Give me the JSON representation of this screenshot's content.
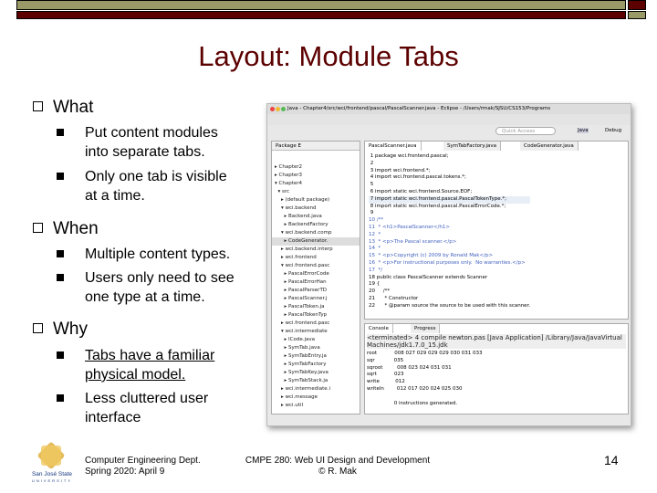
{
  "colors": {
    "olive": "#9a9a68",
    "maroon": "#5c0000"
  },
  "title": "Layout: Module Tabs",
  "bullets": [
    {
      "label": "What",
      "items": [
        "Put content modules into separate tabs.",
        "Only one tab is visible at a time."
      ]
    },
    {
      "label": "When",
      "items": [
        "Multiple content types.",
        "Users only need to see one type at a time."
      ]
    },
    {
      "label": "Why",
      "items": [
        "Tabs have a familiar physical model.",
        "Less cluttered user interface"
      ]
    }
  ],
  "footer": {
    "dept": "Computer Engineering Dept.",
    "date": "Spring 2020: April 9",
    "course": "CMPE 280: Web UI Design and Development",
    "author": "© R. Mak",
    "page": "14",
    "logo_text": "San José State UNIVERSITY"
  },
  "eclipse": {
    "window_title": "Java - Chapter4/src/wci/frontend/pascal/PascalScanner.java - Eclipse - /Users/rmak/SJSU/CS153/Programs",
    "quick_access": "Quick Access",
    "perspectives": [
      "Java",
      "Debug"
    ],
    "package_tab": "Package E",
    "tree": [
      "▸ Chapter2",
      "▸ Chapter3",
      "▾ Chapter4",
      "  ▾ src",
      "    ▸ (default package)",
      "    ▾ wci.backend",
      "      ▸ Backend.java",
      "      ▸ BackendFactory",
      "    ▾ wci.backend.comp",
      "      ▸ CodeGenerator.",
      "    ▸ wci.backend.interp",
      "    ▸ wci.frontend",
      "    ▾ wci.frontend.pasc",
      "      ▸ PascalErrorCode",
      "      ▸ PascalErrorHan",
      "      ▸ PascalParserTD",
      "      ▸ PascalScanner.j",
      "      ▸ PascalToken.ja",
      "      ▸ PascalTokenTyp",
      "    ▸ wci.frontend.pasc",
      "    ▾ wci.intermediate",
      "      ▸ ICode.java",
      "      ▸ SymTab.java",
      "      ▸ SymTabEntry.ja",
      "      ▸ SymTabFactory",
      "      ▸ SymTabKey.java",
      "      ▸ SymTabStack.ja",
      "    ▸ wci.intermediate.i",
      "    ▸ wci.message",
      "    ▸ wci.util"
    ],
    "editor_tabs": [
      "PascalScanner.java",
      "SymTabFactory.java",
      "CodeGenerator.java"
    ],
    "code": [
      " 1 package wci.frontend.pascal;",
      " 2",
      " 3 import wci.frontend.*;",
      " 4 import wci.frontend.pascal.tokens.*;",
      " 5",
      " 6 import static wci.frontend.Source.EOF;",
      " 7 import static wci.frontend.pascal.PascalTokenType.*;",
      " 8 import static wci.frontend.pascal.PascalErrorCode.*;",
      " 9",
      "10 /**",
      "11  * <h1>PascalScanner</h1>",
      "12  *",
      "13  * <p>The Pascal scanner.</p>",
      "14  *",
      "15  * <p>Copyright (c) 2009 by Ronald Mak</p>",
      "16  * <p>For instructional purposes only.  No warranties.</p>",
      "17  */",
      "18 public class PascalScanner extends Scanner",
      "19 {",
      "20     /**",
      "21      * Constructor",
      "22      * @param source the source to be used with this scanner."
    ],
    "console_tabs": [
      "Console",
      "Progress"
    ],
    "console_header": "<terminated> 4 compile newton.pas [Java Application] /Library/Java/JavaVirtualMachines/jdk1.7.0_15.jdk",
    "console": [
      "root           008 027 029 029 029 030 031 033",
      "sqr            035",
      "sqroot         008 023 024 031 031",
      "sqrt           023",
      "write          012",
      "writeln        012 017 020 024 025 030",
      "",
      "                 0 instructions generated."
    ]
  }
}
